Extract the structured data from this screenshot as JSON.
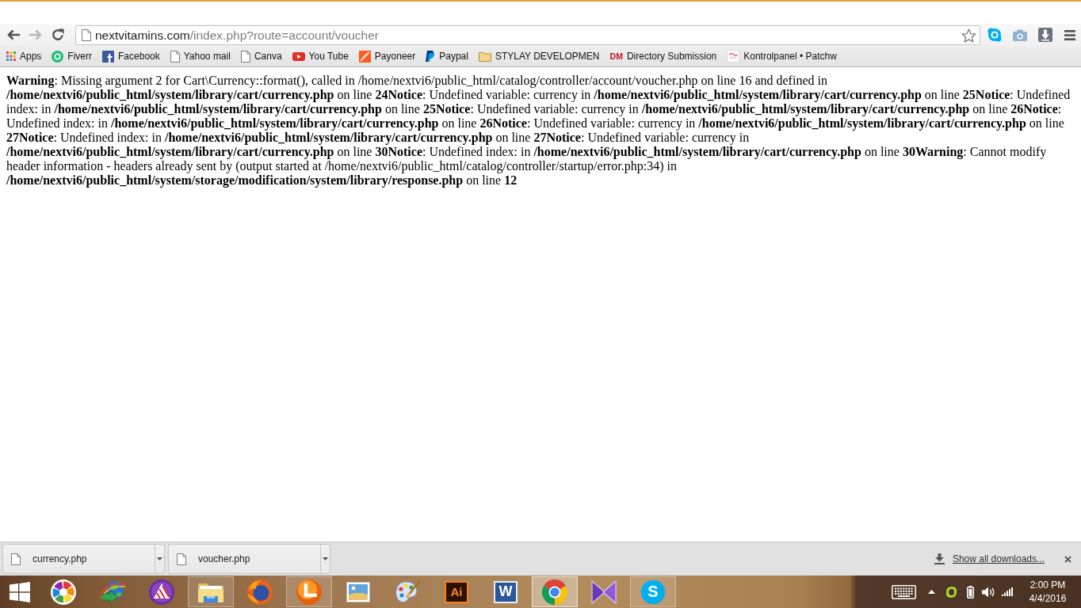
{
  "toolbar": {
    "back": {
      "disabled": false
    },
    "forward": {
      "disabled": true
    },
    "address": {
      "domain": "nextvitamins.com",
      "path": "/index.php?route=account/voucher",
      "starred": false
    }
  },
  "bookmarks": [
    {
      "label": "Apps",
      "kind": "grid"
    },
    {
      "label": "Fiverr",
      "kind": "round"
    },
    {
      "label": "Facebook",
      "kind": "square"
    },
    {
      "label": "Yahoo mail",
      "kind": "page"
    },
    {
      "label": "Canva",
      "kind": "page"
    },
    {
      "label": "You Tube",
      "kind": "play"
    },
    {
      "label": "Payoneer",
      "kind": "tile"
    },
    {
      "label": "Paypal",
      "kind": "slanted"
    },
    {
      "label": "STYLAY DEVELOPMEN",
      "kind": "folder"
    },
    {
      "label": "Directory Submission",
      "kind": "letters",
      "logo_text": "DM"
    },
    {
      "label": "Kontrolpanel • Patchw",
      "kind": "thumbnail"
    }
  ],
  "page": {
    "error_text": "**Warning**: Missing argument 2 for Cart\\Currency::format(), called in /home/nextvi6/public_html/catalog/controller/account/voucher.php on line 16 and defined in **/home/nextvi6/public_html/system/library/cart/currency.php** on line **24Notice**: Undefined variable: currency in **/home/nextvi6/public_html/system/library/cart/currency.php** on line **25Notice**: Undefined index: in **/home/nextvi6/public_html/system/library/cart/currency.php** on line **25Notice**: Undefined variable: currency in **/home/nextvi6/public_html/system/library/cart/currency.php** on line **26Notice**: Undefined index: in **/home/nextvi6/public_html/system/library/cart/currency.php** on line **26Notice**: Undefined variable: currency in **/home/nextvi6/public_html/system/library/cart/currency.php** on line **27Notice**: Undefined index: in **/home/nextvi6/public_html/system/library/cart/currency.php** on line **27Notice**: Undefined variable: currency in **/home/nextvi6/public_html/system/library/cart/currency.php** on line **30Notice**: Undefined index: in **/home/nextvi6/public_html/system/library/cart/currency.php** on line **30Warning**: Cannot modify header information - headers already sent by (output started at /home/nextvi6/public_html/catalog/controller/startup/error.php:34) in **/home/nextvi6/public_html/system/storage/modification/system/library/response.php** on line **12**"
  },
  "downloads": {
    "items": [
      {
        "name": "currency.php"
      },
      {
        "name": "voucher.php"
      }
    ],
    "show_all": "Show all downloads..."
  },
  "taskbar": {
    "apps": [
      {
        "kind": "pinwheel",
        "running": false,
        "active": false
      },
      {
        "kind": "globe-arrow",
        "running": false,
        "active": false
      },
      {
        "kind": "striped-triangle",
        "running": false,
        "active": false
      },
      {
        "kind": "folder",
        "running": true,
        "active": false
      },
      {
        "kind": "fox-globe",
        "running": false,
        "active": false
      },
      {
        "kind": "swirl",
        "running": true,
        "active": false
      },
      {
        "kind": "picture",
        "running": false,
        "active": false
      },
      {
        "kind": "palette",
        "running": false,
        "active": false
      },
      {
        "kind": "letter-tile",
        "logo_text": "Ai",
        "running": false,
        "active": false
      },
      {
        "kind": "letter-doc",
        "logo_text": "W",
        "running": false,
        "active": false
      },
      {
        "kind": "ring",
        "running": true,
        "active": true
      },
      {
        "kind": "bowtie",
        "running": false,
        "active": false
      },
      {
        "kind": "letter-blob",
        "logo_text": "S",
        "running": true,
        "active": false
      }
    ],
    "clock": {
      "time": "2:00 PM",
      "date": "4/4/2016"
    }
  }
}
